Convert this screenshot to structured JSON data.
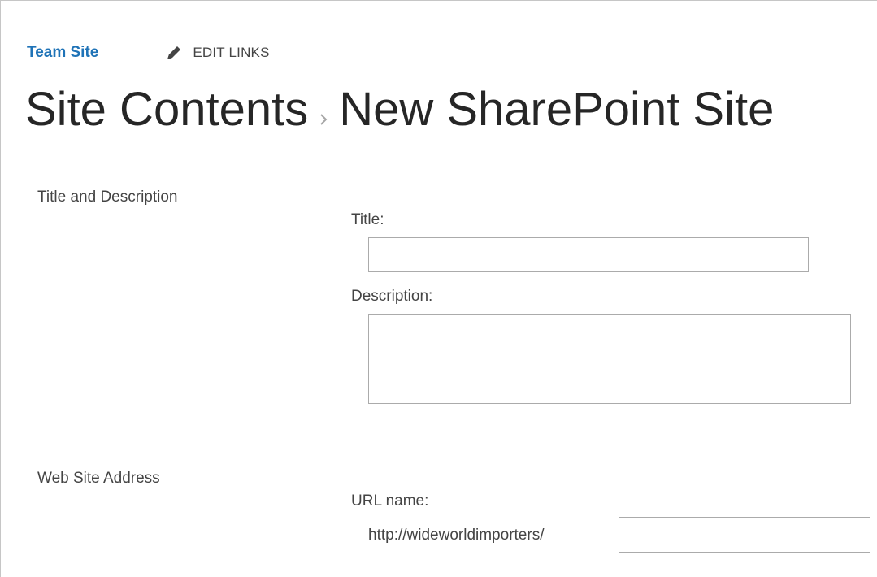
{
  "nav": {
    "site_link": "Team Site",
    "edit_links_label": "EDIT LINKS",
    "edit_icon": "pencil-icon"
  },
  "breadcrumb": {
    "parent": "Site Contents",
    "separator_icon": "chevron-right-icon",
    "current": "New SharePoint Site"
  },
  "title_section": {
    "heading": "Title and Description",
    "title_label": "Title:",
    "title_value": "",
    "description_label": "Description:",
    "description_value": ""
  },
  "address_section": {
    "heading": "Web Site Address",
    "url_label": "URL name:",
    "url_prefix": "http://wideworldimporters/",
    "url_value": ""
  },
  "colors": {
    "link": "#1f73b7",
    "title_text": "#262626",
    "body_text": "#444444",
    "input_border": "#ababab"
  }
}
